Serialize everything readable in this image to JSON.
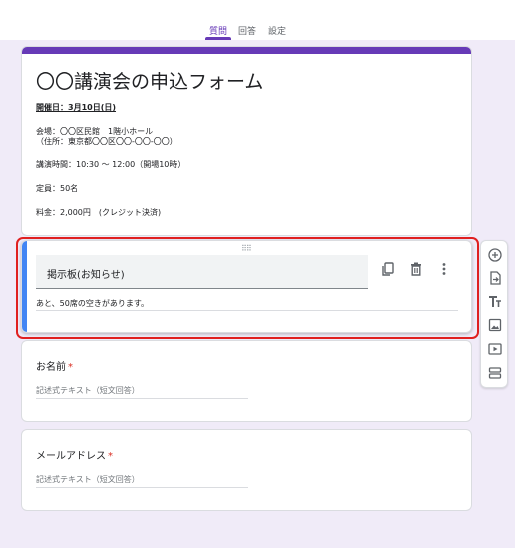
{
  "tabs": [
    {
      "label": "質問",
      "active": true
    },
    {
      "label": "回答",
      "active": false
    },
    {
      "label": "設定",
      "active": false
    }
  ],
  "form": {
    "title": "〇〇講演会の申込フォーム",
    "description": {
      "date": "開催日：3月10日(日)",
      "venue": "会場：〇〇区民館　1階小ホール",
      "address": "（住所：東京都〇〇区〇〇-〇〇-〇〇）",
      "time": "講演時間：10:30 ～ 12:00（開場10時）",
      "capacity": "定員：50名",
      "fee": "料金：2,000円　(クレジット決済)"
    }
  },
  "active_item": {
    "title": "掲示板(お知らせ)",
    "description": "あと、50席の空きがあります。",
    "actions": [
      "copy-icon",
      "delete-icon",
      "more-vert-icon"
    ]
  },
  "questions": [
    {
      "label": "お名前",
      "required_mark": "*",
      "placeholder": "記述式テキスト（短文回答）"
    },
    {
      "label": "メールアドレス",
      "required_mark": "*",
      "placeholder": "記述式テキスト（短文回答）"
    }
  ],
  "side_toolbar": [
    "add-question-icon",
    "import-icon",
    "add-title-icon",
    "add-image-icon",
    "add-video-icon",
    "add-section-icon"
  ],
  "colors": {
    "accent": "#673ab7",
    "active_bar": "#4285f4",
    "highlight": "#e02020",
    "background": "#f0ebf8"
  }
}
